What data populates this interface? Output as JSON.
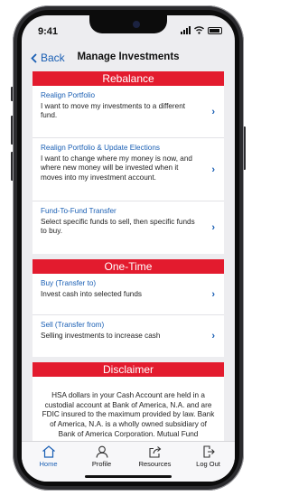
{
  "status": {
    "time": "9:41"
  },
  "nav": {
    "back_label": "Back",
    "title": "Manage Investments"
  },
  "sections": {
    "rebalance": {
      "header": "Rebalance",
      "items": [
        {
          "title": "Realign Portfolio",
          "desc": "I want to move my investments to a different fund."
        },
        {
          "title": "Realign Portfolio & Update Elections",
          "desc": "I want to change where my money is now, and where new money will be invested when it moves into my investment account."
        },
        {
          "title": "Fund-To-Fund Transfer",
          "desc": "Select specific funds to sell, then specific funds to buy."
        }
      ]
    },
    "onetime": {
      "header": "One-Time",
      "items": [
        {
          "title": "Buy (Transfer to)",
          "desc": "Invest cash into selected funds"
        },
        {
          "title": "Sell (Transfer from)",
          "desc": "Selling investments to increase cash"
        }
      ]
    },
    "disclaimer": {
      "header": "Disclaimer",
      "text": "HSA dollars in your Cash Account are held in a custodial account at Bank of America, N.A. and are FDIC insured to the maximum provided by law. Bank of America, N.A. is a wholly owned subsidiary of Bank of America Corporation. Mutual Fund"
    }
  },
  "tabbar": {
    "tabs": [
      {
        "label": "Home",
        "icon": "home-icon"
      },
      {
        "label": "Profile",
        "icon": "person-icon"
      },
      {
        "label": "Resources",
        "icon": "share-icon"
      },
      {
        "label": "Log Out",
        "icon": "logout-icon"
      }
    ]
  },
  "colors": {
    "accent": "#1a5fb4",
    "brand_red": "#e31b2e"
  }
}
